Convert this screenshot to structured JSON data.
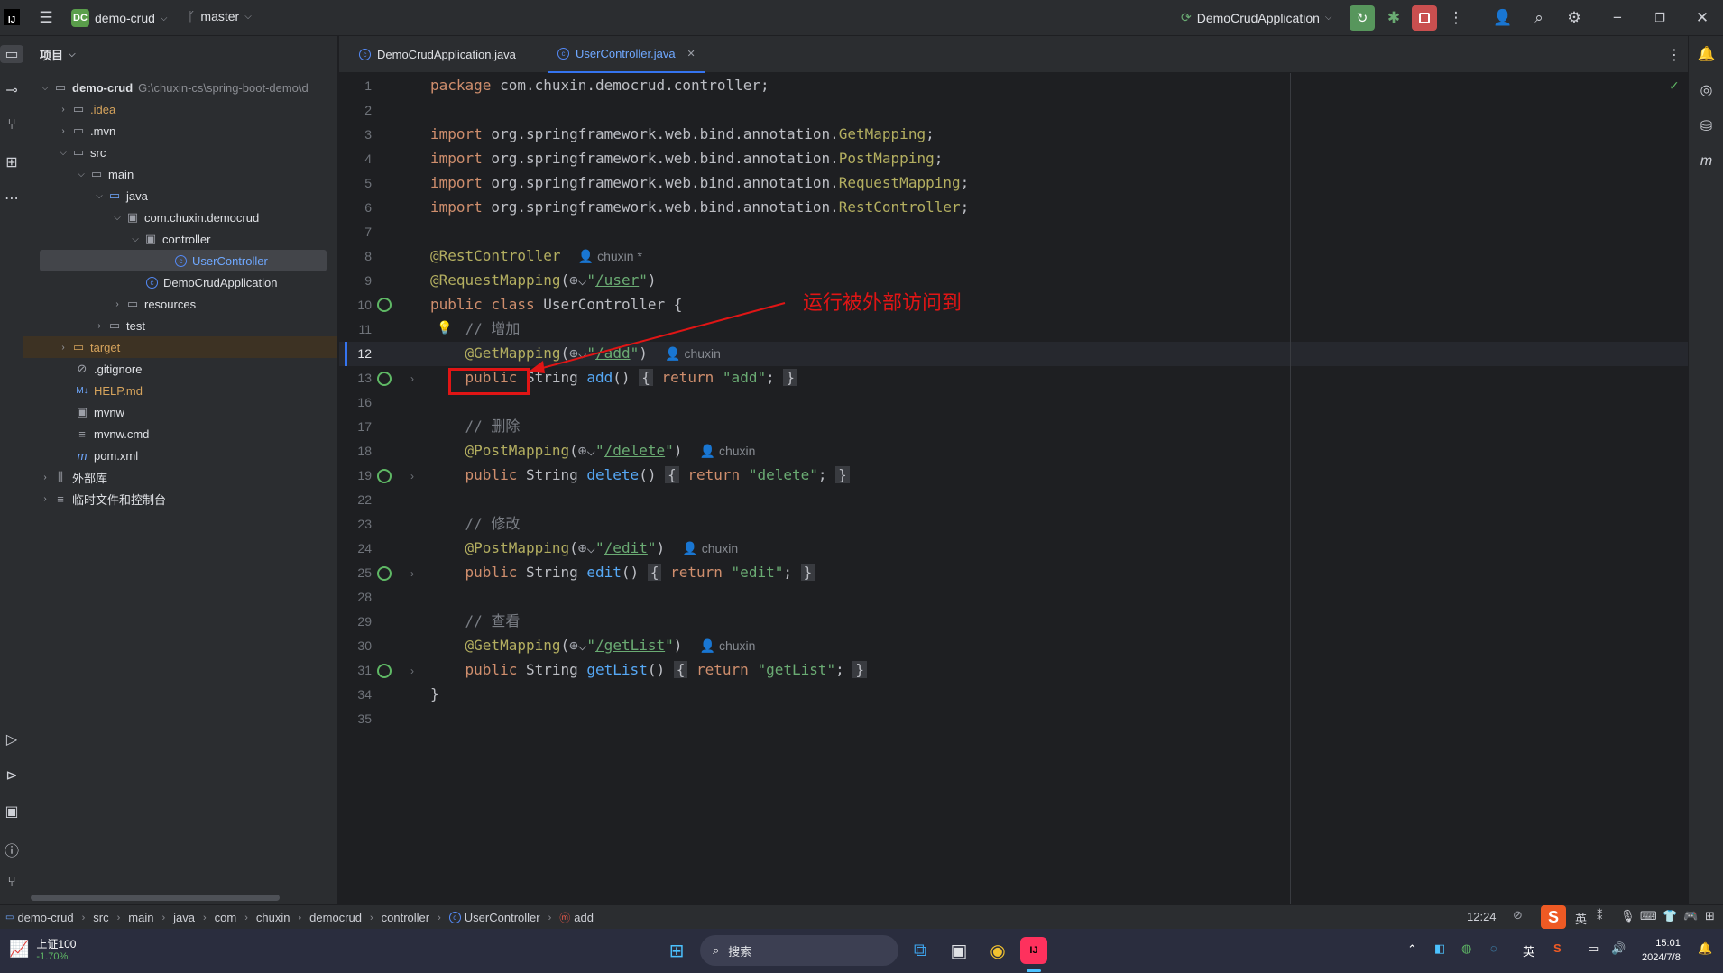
{
  "titlebar": {
    "project_badge": "DC",
    "project_name": "demo-crud",
    "branch": "master",
    "run_config": "DemoCrudApplication"
  },
  "project_panel": {
    "header": "项目",
    "tree": [
      {
        "label": "demo-crud",
        "hint": "G:\\chuxin-cs\\spring-boot-demo\\d",
        "icon": "folder"
      },
      {
        "label": ".idea",
        "icon": "folder"
      },
      {
        "label": ".mvn",
        "icon": "folder"
      },
      {
        "label": "src",
        "icon": "folder"
      },
      {
        "label": "main",
        "icon": "folder"
      },
      {
        "label": "java",
        "icon": "folder"
      },
      {
        "label": "com.chuxin.democrud",
        "icon": "package"
      },
      {
        "label": "controller",
        "icon": "package"
      },
      {
        "label": "UserController",
        "icon": "class"
      },
      {
        "label": "DemoCrudApplication",
        "icon": "class"
      },
      {
        "label": "resources",
        "icon": "folder"
      },
      {
        "label": "test",
        "icon": "folder"
      },
      {
        "label": "target",
        "icon": "folder"
      },
      {
        "label": ".gitignore",
        "icon": "ignore"
      },
      {
        "label": "HELP.md",
        "icon": "markdown"
      },
      {
        "label": "mvnw",
        "icon": "terminal"
      },
      {
        "label": "mvnw.cmd",
        "icon": "text"
      },
      {
        "label": "pom.xml",
        "icon": "maven"
      },
      {
        "label": "外部库",
        "icon": "library"
      },
      {
        "label": "临时文件和控制台",
        "icon": "scratches"
      }
    ]
  },
  "tabs": [
    {
      "label": "DemoCrudApplication.java"
    },
    {
      "label": "UserController.java"
    }
  ],
  "editor": {
    "line_numbers": [
      "1",
      "2",
      "3",
      "4",
      "5",
      "6",
      "7",
      "8",
      "9",
      "10",
      "11",
      "12",
      "13",
      "16",
      "17",
      "18",
      "19",
      "22",
      "23",
      "24",
      "25",
      "28",
      "29",
      "30",
      "31",
      "34",
      "35"
    ],
    "code": {
      "pkg_kw": "package",
      "pkg_name": " com.chuxin.democrud.controller;",
      "import_kw": "import",
      "imp_prefix": " org.springframework.web.bind.annotation.",
      "imp1": "GetMapping",
      "imp2": "PostMapping",
      "imp3": "RequestMapping",
      "imp4": "RestController",
      "semi": ";",
      "rest_controller": "@RestController",
      "author": "chuxin",
      "author_star": "chuxin *",
      "request_mapping": "@RequestMapping",
      "get_mapping": "@GetMapping",
      "post_mapping": "@PostMapping",
      "path_user": "/user",
      "path_add": "/add",
      "path_delete": "/delete",
      "path_edit": "/edit",
      "path_getlist": "/getList",
      "public": "public",
      "class_kw": "class",
      "class_name": " UserController {",
      "string_type": " String ",
      "m_add": "add",
      "m_delete": "delete",
      "m_edit": "edit",
      "m_getlist": "getList",
      "parens": "()",
      "open_fold": "{",
      "close_fold": "}",
      "return_kw": "return",
      "ret_add": "\"add\"",
      "ret_delete": "\"delete\"",
      "ret_edit": "\"edit\"",
      "ret_getlist": "\"getList\"",
      "cmt_add": "// 增加",
      "cmt_delete": "// 删除",
      "cmt_edit": "// 修改",
      "cmt_query": "// 查看",
      "close_brace": "}"
    }
  },
  "annotation": {
    "text": "运行被外部访问到",
    "color": "#e01515"
  },
  "breadcrumb": [
    "demo-crud",
    "src",
    "main",
    "java",
    "com",
    "chuxin",
    "democrud",
    "controller",
    "UserController",
    "add"
  ],
  "status": {
    "position": "12:24"
  },
  "taskbar": {
    "stock_name": "上证100",
    "stock_change": "-1.70%",
    "search_placeholder": "搜索",
    "ime": "英",
    "time": "15:01",
    "date": "2024/7/8"
  }
}
